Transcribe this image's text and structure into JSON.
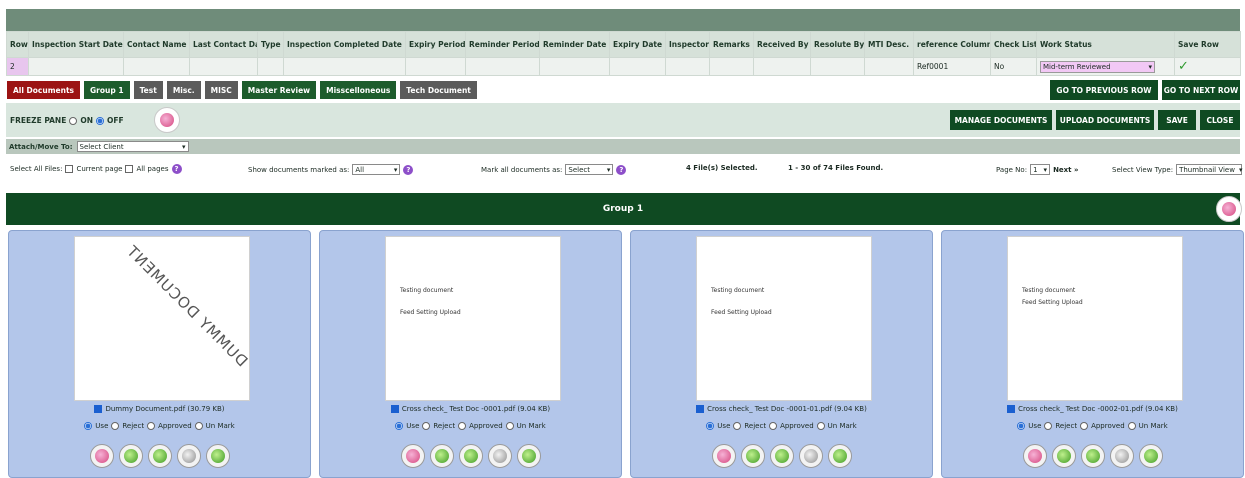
{
  "header_table": {
    "columns": [
      "Row No.",
      "Inspection Start Date",
      "Contact Name",
      "Last Contact Date",
      "Type",
      "Inspection Completed Date",
      "Expiry Period",
      "Reminder Period",
      "Reminder Date",
      "Expiry Date",
      "Inspector",
      "Remarks",
      "Received By",
      "Resolute By",
      "MTI Desc.",
      "reference Column",
      "Check List",
      "Work Status",
      "Save Row"
    ],
    "row": {
      "row_no": "2",
      "reference": "Ref0001",
      "check_list": "No",
      "work_status": "Mid-term Reviewed"
    }
  },
  "tabs": [
    "All Documents",
    "Group 1",
    "Test",
    "Misc.",
    "MISC",
    "Master Review",
    "Misscelloneous",
    "Tech Document"
  ],
  "nav": {
    "previous": "GO TO PREVIOUS ROW",
    "next": "GO TO NEXT ROW"
  },
  "freeze": {
    "label": "FREEZE PANE",
    "on": "ON",
    "off": "OFF"
  },
  "actions": {
    "manage": "MANAGE DOCUMENTS",
    "upload": "UPLOAD DOCUMENTS",
    "save": "SAVE",
    "close": "CLOSE"
  },
  "attach": {
    "label": "Attach/Move To:",
    "value": "Select Client"
  },
  "options": {
    "select_all": "Select All Files:",
    "current_page": "Current page",
    "all_pages": "All pages",
    "show_marked_label": "Show documents marked as:",
    "show_marked_value": "All",
    "mark_all_label": "Mark all documents as:",
    "mark_all_value": "Select",
    "selected": "4 File(s) Selected.",
    "found": "1 - 30 of 74 Files Found.",
    "page_label": "Page No:",
    "page_value": "1",
    "next": "Next »",
    "view_label": "Select View Type:",
    "view_value": "Thumbnail View"
  },
  "group_title": "Group 1",
  "cards": [
    {
      "name": "Dummy Document.pdf (30.79 KB)",
      "diag": "DUMMY DOCUMENT",
      "line1": "",
      "line2": ""
    },
    {
      "name": "Cross check_ Test Doc -0001.pdf (9.04 KB)",
      "diag": "",
      "line1": "Testing document",
      "line2": "Feed Setting Upload"
    },
    {
      "name": "Cross check_ Test Doc -0001-01.pdf (9.04 KB)",
      "diag": "",
      "line1": "Testing document",
      "line2": "Feed Setting Upload"
    },
    {
      "name": "Cross check_ Test Doc -0002-01.pdf (9.04 KB)",
      "diag": "",
      "line1": "Testing document",
      "line2": "Feed Setting Upload"
    }
  ],
  "mark_options": [
    "Use",
    "Reject",
    "Approved",
    "Un Mark"
  ]
}
